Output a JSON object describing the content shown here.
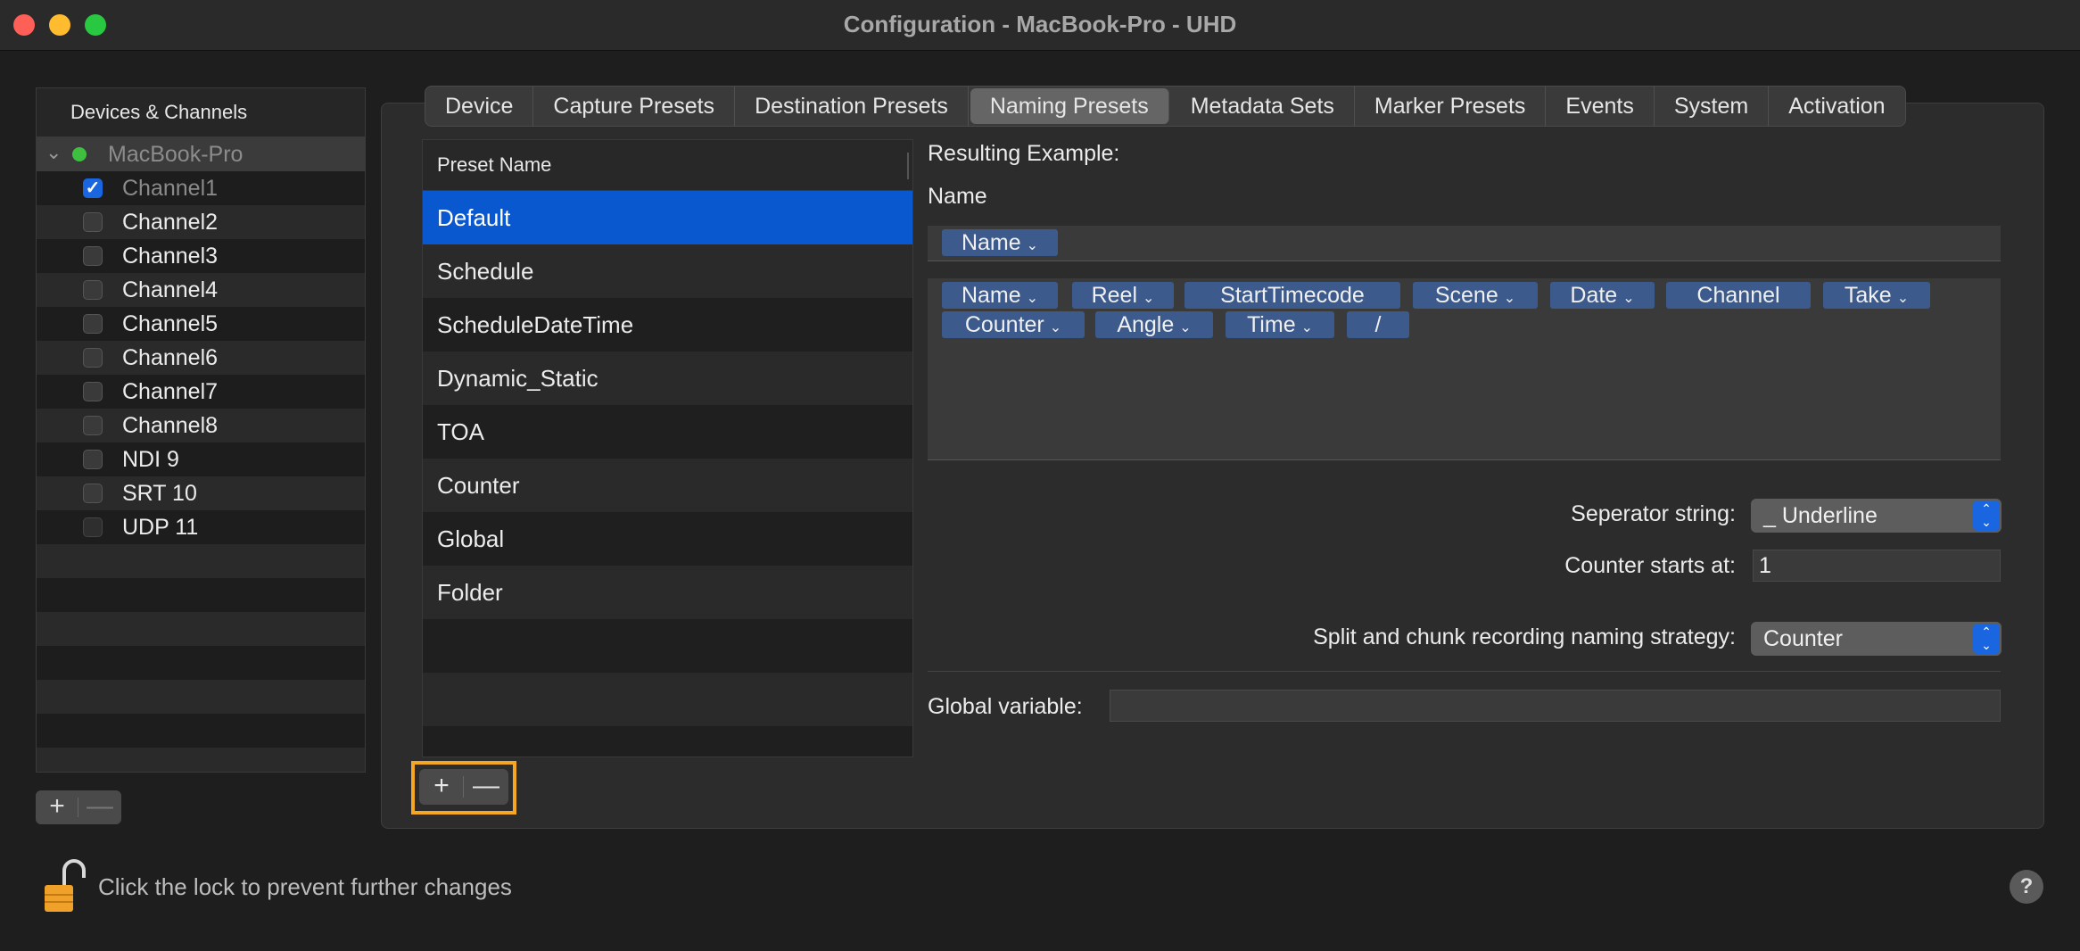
{
  "window": {
    "title": "Configuration - MacBook-Pro - UHD"
  },
  "sidebar": {
    "header": "Devices & Channels",
    "device": {
      "name": "MacBook-Pro",
      "status_color": "#3fbf3f"
    },
    "channels": [
      {
        "label": "Channel1",
        "checked": true
      },
      {
        "label": "Channel2",
        "checked": false
      },
      {
        "label": "Channel3",
        "checked": false
      },
      {
        "label": "Channel4",
        "checked": false
      },
      {
        "label": "Channel5",
        "checked": false
      },
      {
        "label": "Channel6",
        "checked": false
      },
      {
        "label": "Channel7",
        "checked": false
      },
      {
        "label": "Channel8",
        "checked": false
      },
      {
        "label": "NDI 9",
        "checked": false
      },
      {
        "label": "SRT 10",
        "checked": false
      },
      {
        "label": "UDP 11",
        "checked": false
      }
    ],
    "add_label": "+",
    "remove_label": "—"
  },
  "tabs": [
    "Device",
    "Capture Presets",
    "Destination Presets",
    "Naming Presets",
    "Metadata Sets",
    "Marker Presets",
    "Events",
    "System",
    "Activation"
  ],
  "active_tab": "Naming Presets",
  "preset_list": {
    "header": "Preset Name",
    "items": [
      "Default",
      "Schedule",
      "ScheduleDateTime",
      "Dynamic_Static",
      "TOA",
      "Counter",
      "Global",
      "Folder"
    ],
    "selected": "Default",
    "add_label": "+",
    "remove_label": "—"
  },
  "editor": {
    "resulting_example_label": "Resulting Example:",
    "name_label": "Name",
    "name_tokens": [
      "Name"
    ],
    "available_tokens": [
      "Name",
      "Reel",
      "StartTimecode",
      "Scene",
      "Date",
      "Channel",
      "Take",
      "Counter",
      "Angle",
      "Time",
      "/"
    ],
    "separator_label": "Seperator string:",
    "separator_value": "_ Underline",
    "counter_label": "Counter starts at:",
    "counter_value": "1",
    "split_label": "Split and chunk recording naming strategy:",
    "split_value": "Counter",
    "global_label": "Global variable:",
    "global_value": ""
  },
  "footer": {
    "lock_text": "Click the lock to prevent further changes",
    "help_label": "?"
  },
  "colors": {
    "accent": "#0a58d0",
    "token_bg": "#3c5a8c",
    "highlight_box": "#f5a623"
  }
}
